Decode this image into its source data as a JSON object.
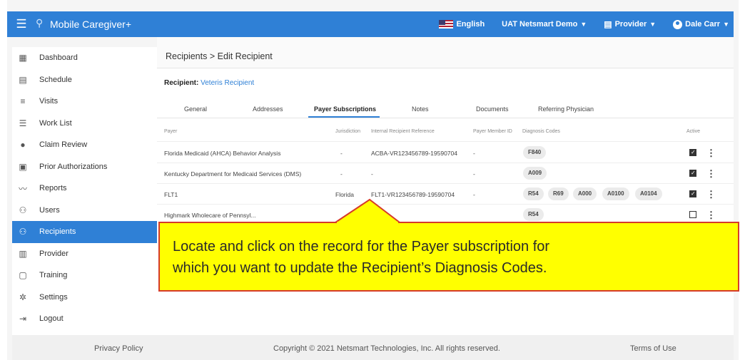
{
  "app": {
    "title": "Mobile Caregiver+",
    "language": "English",
    "organization": "UAT Netsmart Demo",
    "role": "Provider",
    "user": "Dale Carr"
  },
  "sidebar": {
    "items": [
      {
        "label": "Dashboard",
        "icon": "dashboard-icon"
      },
      {
        "label": "Schedule",
        "icon": "calendar-icon"
      },
      {
        "label": "Visits",
        "icon": "filter-icon"
      },
      {
        "label": "Work List",
        "icon": "list-icon"
      },
      {
        "label": "Claim Review",
        "icon": "alert-icon"
      },
      {
        "label": "Prior Authorizations",
        "icon": "calendar-check-icon"
      },
      {
        "label": "Reports",
        "icon": "chart-line-icon"
      },
      {
        "label": "Users",
        "icon": "users-icon"
      },
      {
        "label": "Recipients",
        "icon": "recipients-icon"
      },
      {
        "label": "Provider",
        "icon": "building-icon"
      },
      {
        "label": "Training",
        "icon": "training-icon"
      },
      {
        "label": "Settings",
        "icon": "gear-icon"
      },
      {
        "label": "Logout",
        "icon": "logout-icon"
      }
    ],
    "active": "Recipients"
  },
  "breadcrumb": {
    "parent": "Recipients",
    "separator": ">",
    "current": "Edit Recipient"
  },
  "recipient": {
    "label": "Recipient:",
    "name": "Veteris Recipient"
  },
  "tabs": [
    "General",
    "Addresses",
    "Payer Subscriptions",
    "Notes",
    "Documents",
    "Referring Physician"
  ],
  "active_tab": "Payer Subscriptions",
  "table": {
    "headers": {
      "payer": "Payer",
      "jurisdiction": "Jurisdiction",
      "reference": "Internal Recipient Reference",
      "member_id": "Payer Member ID",
      "diagnosis": "Diagnosis Codes",
      "active": "Active"
    },
    "rows": [
      {
        "payer": "Florida Medicaid (AHCA) Behavior Analysis",
        "jurisdiction": "-",
        "reference": "ACBA-VR123456789-19590704",
        "member_id": "-",
        "codes": [
          "F840"
        ],
        "active": true
      },
      {
        "payer": "Kentucky Department for Medicaid Services (DMS)",
        "jurisdiction": "-",
        "reference": "-",
        "member_id": "-",
        "codes": [
          "A009"
        ],
        "active": true
      },
      {
        "payer": "FLT1",
        "jurisdiction": "Florida",
        "reference": "FLT1-VR123456789-19590704",
        "member_id": "-",
        "codes": [
          "R54",
          "R69",
          "A000",
          "A0100",
          "A0104"
        ],
        "active": true
      },
      {
        "payer": "Highmark Wholecare of Pennsyl...",
        "jurisdiction": "",
        "reference": "",
        "member_id": "",
        "codes": [
          "R54"
        ],
        "active": false
      }
    ]
  },
  "footer": {
    "privacy": "Privacy Policy",
    "copyright": "Copyright © 2021 Netsmart Technologies, Inc. All rights reserved.",
    "terms": "Terms of Use"
  },
  "callout": {
    "line1": "Locate and click on the record for the Payer subscription for",
    "line2": "which you want to update the Recipient’s Diagnosis Codes."
  },
  "colors": {
    "primary": "#2f80d6",
    "callout_bg": "#ffff00",
    "callout_border": "#d63a2a"
  }
}
